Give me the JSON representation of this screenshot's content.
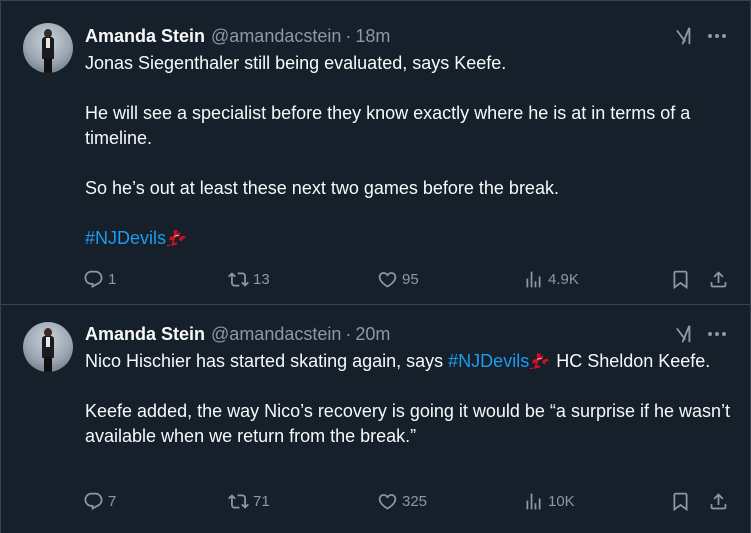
{
  "tweets": [
    {
      "author": "Amanda Stein",
      "handle": "@amandacstein",
      "separator": "·",
      "time": "18m",
      "lines": [
        "Jonas Siegenthaler still being evaluated, says Keefe.",
        "He will see a specialist before they know exactly where he is at in terms of a timeline.",
        "So he’s out at least these next two games before the break."
      ],
      "hashtag": "#NJDevils",
      "replies": "1",
      "reposts": "13",
      "likes": "95",
      "views": "4.9K"
    },
    {
      "author": "Amanda Stein",
      "handle": "@amandacstein",
      "separator": "·",
      "time": "20m",
      "line1_before": "Nico Hischier has started skating again, says ",
      "hashtag": "#NJDevils",
      "line1_after": " HC Sheldon Keefe.",
      "line2": "Keefe added, the way Nico’s recovery is going it would be “a surprise if he wasn’t available when we return from the break.”",
      "replies": "7",
      "reposts": "71",
      "likes": "325",
      "views": "10K"
    }
  ],
  "colors": {
    "background": "#15202b",
    "accent": "#1d9bf0",
    "muted": "#8b98a5",
    "text": "#f7f9f9",
    "devils_red": "#ce1126"
  },
  "icons": [
    "avatar",
    "grok-icon",
    "more-icon",
    "devils-emoji",
    "reply-icon",
    "repost-icon",
    "like-icon",
    "views-icon",
    "bookmark-icon",
    "share-icon"
  ]
}
